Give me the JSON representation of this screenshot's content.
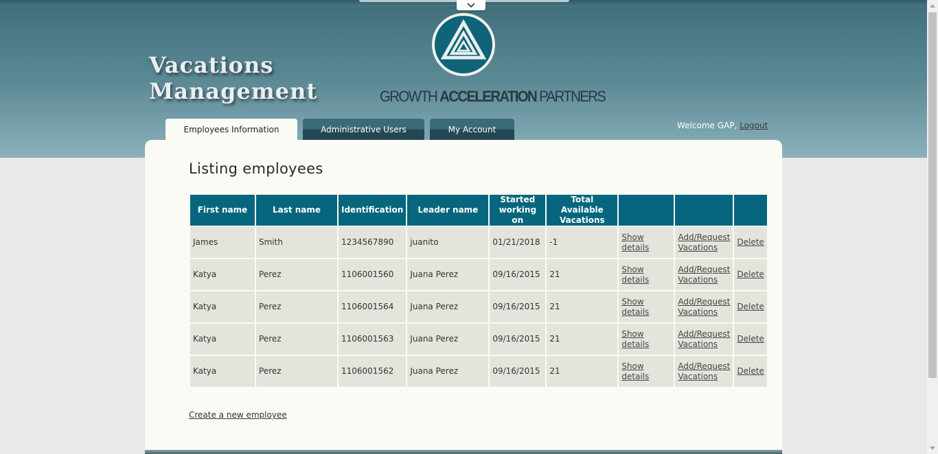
{
  "app": {
    "title_line1": "Vacations",
    "title_line2": "Management",
    "logo_regular_1": "GROWTH ",
    "logo_bold": "ACCELERATION",
    "logo_regular_2": " PARTNERS"
  },
  "tabs": [
    {
      "label": "Employees Information",
      "active": true
    },
    {
      "label": "Administrative Users",
      "active": false
    },
    {
      "label": "My Account",
      "active": false
    }
  ],
  "user": {
    "welcome": "Welcome GAP,",
    "logout": "Logout"
  },
  "page": {
    "heading": "Listing employees",
    "create_link": "Create a new employee"
  },
  "table": {
    "headers": {
      "first_name": "First name",
      "last_name": "Last name",
      "identification": "Identification",
      "leader_name": "Leader name",
      "started_l1": "Started",
      "started_l2": "working on",
      "total_l1": "Total Available",
      "total_l2": "Vacations"
    },
    "rows": [
      {
        "first": "James",
        "last": "Smith",
        "id": "1234567890",
        "leader": "juanito",
        "started": "01/21/2018",
        "total": "-1"
      },
      {
        "first": "Katya",
        "last": "Perez",
        "id": "1106001560",
        "leader": "Juana Perez",
        "started": "09/16/2015",
        "total": "21"
      },
      {
        "first": "Katya",
        "last": "Perez",
        "id": "1106001564",
        "leader": "Juana Perez",
        "started": "09/16/2015",
        "total": "21"
      },
      {
        "first": "Katya",
        "last": "Perez",
        "id": "1106001563",
        "leader": "Juana Perez",
        "started": "09/16/2015",
        "total": "21"
      },
      {
        "first": "Katya",
        "last": "Perez",
        "id": "1106001562",
        "leader": "Juana Perez",
        "started": "09/16/2015",
        "total": "21"
      }
    ],
    "actions": {
      "show_l1": "Show",
      "show_l2": "details",
      "add_l1": "Add/Request",
      "add_l2": "Vacations",
      "delete": "Delete"
    }
  },
  "colors": {
    "header_teal": "#05667d",
    "row_bg": "#e4e4dd",
    "content_bg": "#fafbf5"
  }
}
